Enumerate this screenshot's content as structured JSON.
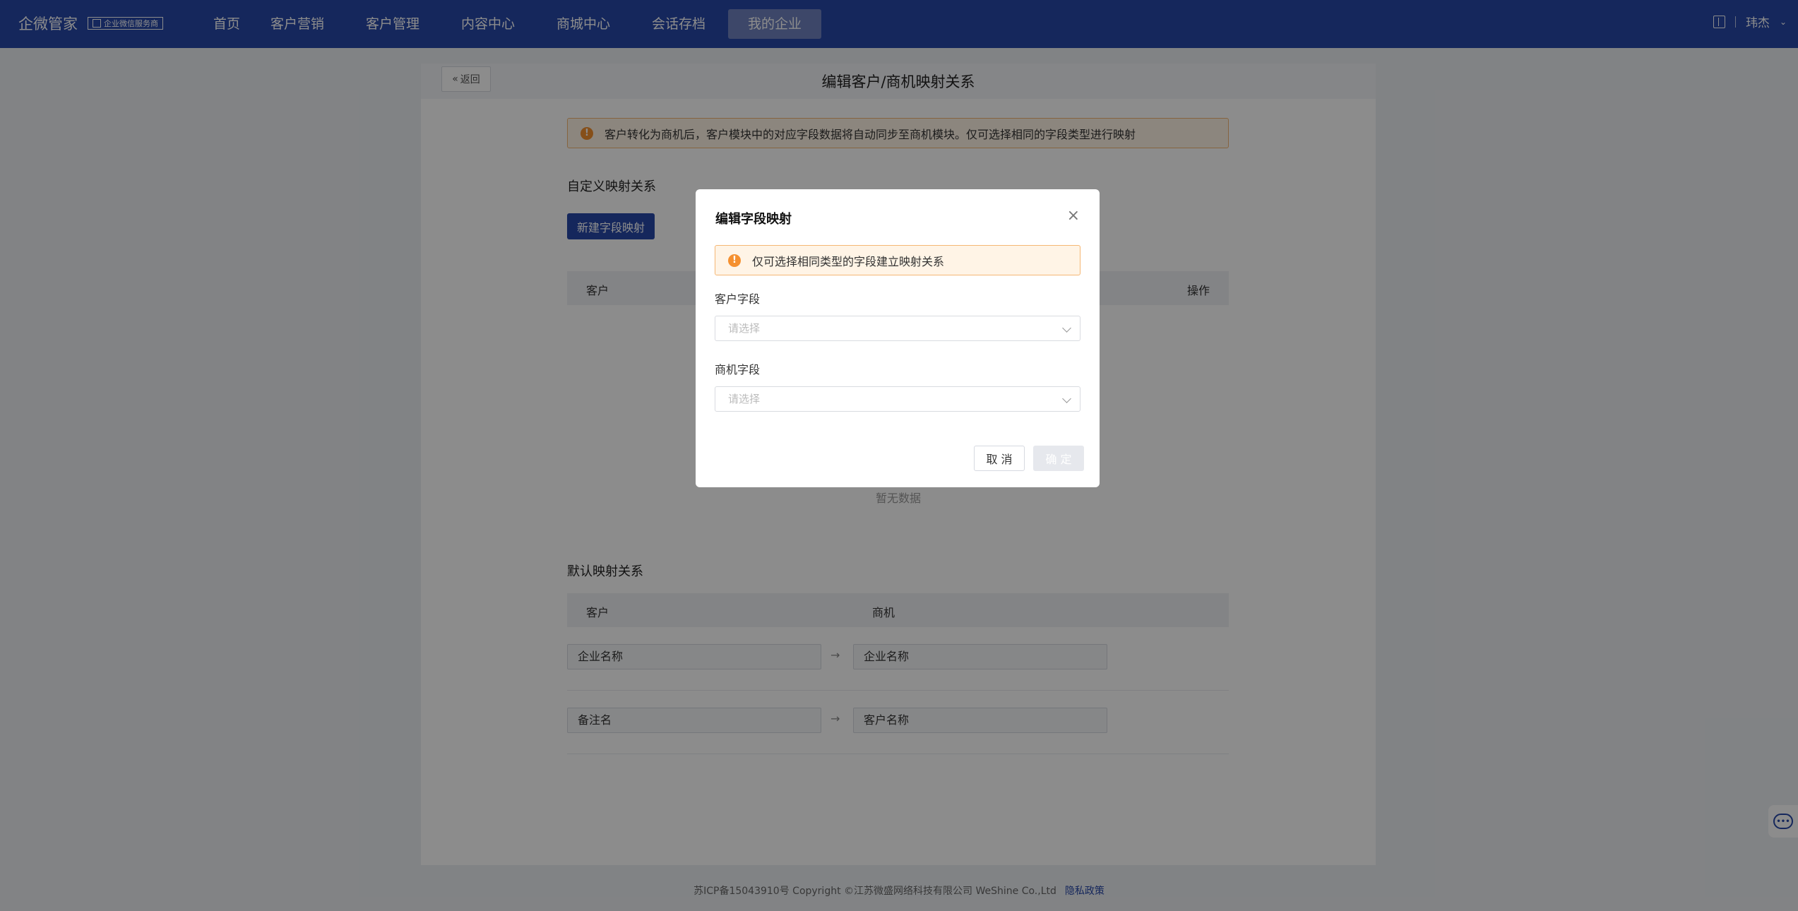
{
  "nav": {
    "logo": "企微管家",
    "logo_badge": "企业微信服务商",
    "items": [
      "首页",
      "客户营销",
      "客户管理",
      "内容中心",
      "商城中心",
      "会话存档",
      "我的企业"
    ],
    "user": "玮杰"
  },
  "page": {
    "back": "返回",
    "title": "编辑客户/商机映射关系",
    "notice": "客户转化为商机后，客户模块中的对应字段数据将自动同步至商机模块。仅可选择相同的字段类型进行映射",
    "custom_title": "自定义映射关系",
    "new_button": "新建字段映射",
    "custom_table": {
      "col_customer": "客户",
      "col_action": "操作"
    },
    "empty_text": "暂无数据",
    "default_title": "默认映射关系",
    "default_table": {
      "col_customer": "客户",
      "col_opportunity": "商机"
    },
    "default_rows": [
      {
        "customer": "企业名称",
        "opportunity": "企业名称"
      },
      {
        "customer": "备注名",
        "opportunity": "客户名称"
      }
    ],
    "arrow": "→"
  },
  "footer": {
    "text": "苏ICP备15043910号 Copyright ©江苏微盛网络科技有限公司 WeShine Co.,Ltd",
    "privacy": "隐私政策"
  },
  "dialog": {
    "title": "编辑字段映射",
    "warning": "仅可选择相同类型的字段建立映射关系",
    "customer_field_label": "客户字段",
    "customer_field_placeholder": "请选择",
    "opportunity_field_label": "商机字段",
    "opportunity_field_placeholder": "请选择",
    "cancel": "取 消",
    "ok": "确 定"
  },
  "colors": {
    "brand": "#2747a8",
    "warning": "#f5902f"
  }
}
